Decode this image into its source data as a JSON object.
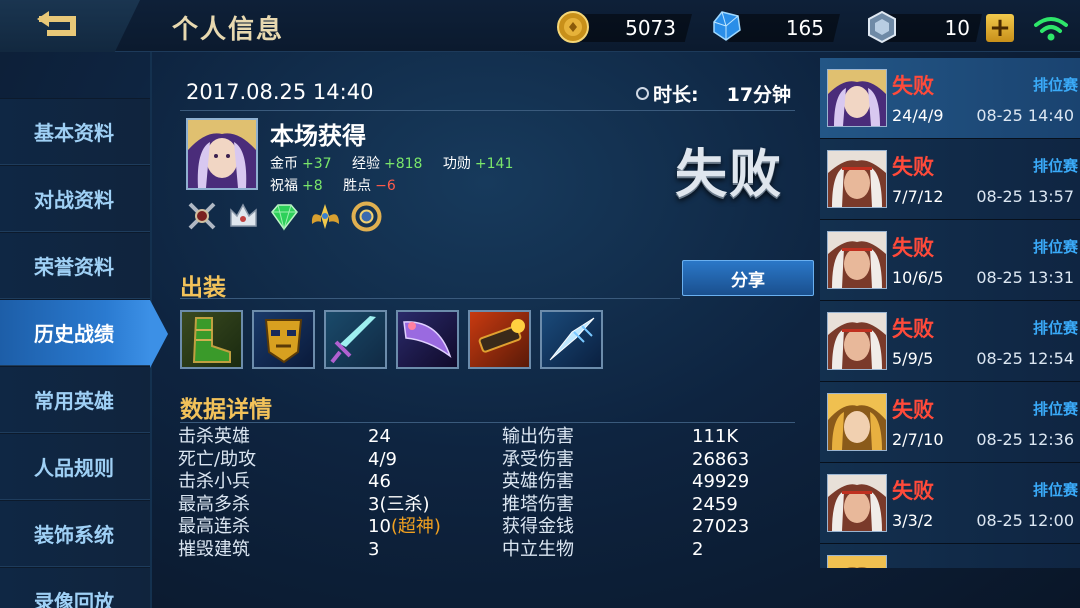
{
  "header": {
    "title": "个人信息",
    "back_icon": "back-arrow-icon",
    "gold": "5073",
    "diamond": "165",
    "voucher": "10",
    "plus_label": "+",
    "colors": {
      "gold": "#f2c94c",
      "diamond": "#3ea8ff",
      "wifi": "#2ee66a"
    }
  },
  "nav": {
    "items": [
      {
        "label": "基本资料"
      },
      {
        "label": "对战资料"
      },
      {
        "label": "荣誉资料"
      },
      {
        "label": "历史战绩",
        "active": true
      },
      {
        "label": "常用英雄"
      },
      {
        "label": "人品规则"
      },
      {
        "label": "装饰系统"
      },
      {
        "label": "录像回放"
      }
    ]
  },
  "match_detail": {
    "datetime": "2017.08.25 14:40",
    "duration_label": "时长:",
    "duration_value": "17分钟",
    "reward_title": "本场获得",
    "rewards": {
      "gold_label": "金币",
      "gold_value": "+37",
      "exp_label": "经验",
      "exp_value": "+818",
      "merit_label": "功勋",
      "merit_value": "+141",
      "bless_label": "祝福",
      "bless_value": "+8",
      "winpoint_label": "胜点",
      "winpoint_value": "−6"
    },
    "result": "失败",
    "badges": [
      "crossed-swords-badge-icon",
      "silver-crown-badge-icon",
      "green-gem-badge-icon",
      "gold-wings-badge-icon",
      "gold-ring-badge-icon"
    ],
    "build_title": "出装",
    "share_label": "分享",
    "items": [
      "green-boots-item-icon",
      "golden-mask-item-icon",
      "cyan-sword-item-icon",
      "purple-blade-item-icon",
      "fire-cannon-item-icon",
      "ice-spear-item-icon"
    ],
    "stats_title": "数据详情",
    "stats": [
      {
        "k1": "击杀英雄",
        "v1": "24",
        "v1_hl": "",
        "k2": "输出伤害",
        "v2": "111K"
      },
      {
        "k1": "死亡/助攻",
        "v1": "4/9",
        "v1_hl": "",
        "k2": "承受伤害",
        "v2": "26863"
      },
      {
        "k1": "击杀小兵",
        "v1": "46",
        "v1_hl": "",
        "k2": "英雄伤害",
        "v2": "49929"
      },
      {
        "k1": "最高多杀",
        "v1": "3(三杀)",
        "v1_hl": "",
        "k2": "推塔伤害",
        "v2": "2459"
      },
      {
        "k1": "最高连杀",
        "v1": "10",
        "v1_hl": "(超神)",
        "k2": "获得金钱",
        "v2": "27023"
      },
      {
        "k1": "摧毁建筑",
        "v1": "3",
        "v1_hl": "",
        "k2": "中立生物",
        "v2": "2"
      }
    ]
  },
  "history": [
    {
      "result": "失败",
      "mode": "排位赛",
      "kda": "24/4/9",
      "time": "08-25 14:40",
      "selected": true,
      "hero": "purple-hair"
    },
    {
      "result": "失败",
      "mode": "排位赛",
      "kda": "7/7/12",
      "time": "08-25 13:57",
      "hero": "white-hair"
    },
    {
      "result": "失败",
      "mode": "排位赛",
      "kda": "10/6/5",
      "time": "08-25 13:31",
      "hero": "white-hair"
    },
    {
      "result": "失败",
      "mode": "排位赛",
      "kda": "5/9/5",
      "time": "08-25 12:54",
      "hero": "white-hair"
    },
    {
      "result": "失败",
      "mode": "排位赛",
      "kda": "2/7/10",
      "time": "08-25 12:36",
      "hero": "golden-hair"
    },
    {
      "result": "失败",
      "mode": "排位赛",
      "kda": "3/3/2",
      "time": "08-25 12:00",
      "hero": "white-hair"
    }
  ]
}
